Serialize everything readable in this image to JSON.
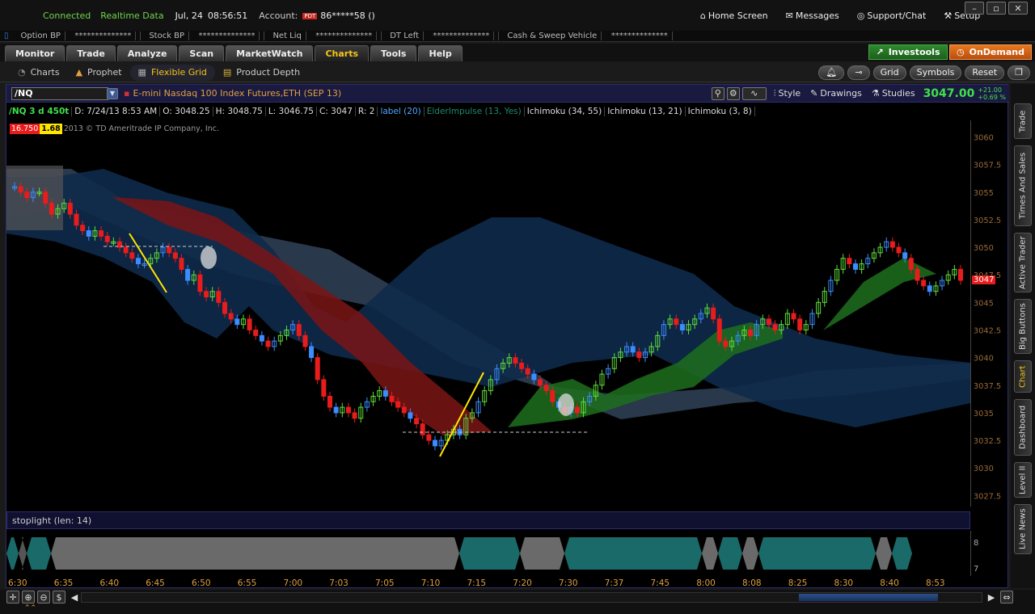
{
  "topbar": {
    "status": "Connected",
    "feed": "Realtime Data",
    "date": "Jul, 24",
    "time": "08:56:51",
    "account_label": "Account:",
    "pdt": "PDT",
    "account": "86*****58 ()",
    "home": "Home Screen",
    "messages": "Messages",
    "support": "Support/Chat",
    "setup": "Setup"
  },
  "acct": {
    "option_bp": "Option BP",
    "option_bp_val": "**************",
    "stock_bp": "Stock BP",
    "stock_bp_val": "**************",
    "net_liq": "Net Liq",
    "net_liq_val": "**************",
    "dt_left": "DT Left",
    "dt_left_val": "**************",
    "cash": "Cash & Sweep Vehicle",
    "cash_val": "**************"
  },
  "tabs": [
    "Monitor",
    "Trade",
    "Analyze",
    "Scan",
    "MarketWatch",
    "Charts",
    "Tools",
    "Help"
  ],
  "brand": {
    "investools": "Investools",
    "ondemand": "OnDemand"
  },
  "subtabs": [
    "Charts",
    "Prophet",
    "Flexible Grid",
    "Product Depth"
  ],
  "right_pills": {
    "grid": "Grid",
    "symbols": "Symbols",
    "reset": "Reset"
  },
  "chart": {
    "symbol": "/NQ",
    "description": "E-mini Nasdaq 100 Index Futures,ETH (SEP 13)",
    "style": "Style",
    "drawings": "Drawings",
    "studies": "Studies",
    "last": "3047.00",
    "change": "+21.00",
    "change_pct": "+0.69 %",
    "info": {
      "agg": "/NQ 3 d 450t",
      "d": "D: 7/24/13 8:53 AM",
      "o": "O: 3048.25",
      "h": "H: 3048.75",
      "l": "L: 3046.75",
      "c": "C: 3047",
      "r": "R: 2",
      "label": "label (20)",
      "elder": "ElderImpulse (13, Yes)",
      "ichi1": "Ichimoku (34, 55)",
      "ichi2": "Ichimoku (13, 21)",
      "ichi3": "Ichimoku (3, 8)"
    },
    "badge_red": "16.750",
    "badge_yellow": "1.68",
    "copyright": "2013 © TD Ameritrade IP Company, Inc.",
    "price_marker": "3047",
    "lower_title": "stoplight (len: 14)"
  },
  "rightside": [
    "Trade",
    "Times And Sales",
    "Active Trader",
    "Big Buttons",
    "Chart",
    "Dashboard",
    "Level II",
    "Live News"
  ],
  "chart_data": {
    "type": "candlestick",
    "title": "/NQ 3 d 450t",
    "y_ticks": [
      3060,
      3057.5,
      3055,
      3052.5,
      3050,
      3047.5,
      3045,
      3042.5,
      3040,
      3037.5,
      3035,
      3032.5,
      3030,
      3027.5
    ],
    "ylim": [
      3026.5,
      3061.5
    ],
    "x_ticks": [
      "6:30",
      "6:35",
      "6:40",
      "6:45",
      "6:50",
      "6:55",
      "7:00",
      "7:03",
      "7:05",
      "7:10",
      "7:15",
      "7:20",
      "7:30",
      "7:37",
      "7:45",
      "8:00",
      "8:08",
      "8:25",
      "8:30",
      "8:40",
      "8:53"
    ],
    "close": [
      3055.5,
      3055,
      3054.5,
      3055,
      3055,
      3054,
      3053,
      3053.5,
      3054,
      3053,
      3052,
      3051.5,
      3051,
      3051.5,
      3051,
      3050.5,
      3050.5,
      3050,
      3049.5,
      3049,
      3048.5,
      3048.5,
      3049,
      3049.5,
      3050,
      3049.5,
      3049,
      3048,
      3047,
      3047.5,
      3046,
      3045.5,
      3046,
      3045,
      3044,
      3043.5,
      3043,
      3043.5,
      3042.5,
      3042,
      3041.5,
      3041,
      3041.5,
      3042,
      3042.5,
      3043,
      3042,
      3041,
      3040,
      3038,
      3036.5,
      3035.5,
      3035,
      3035.5,
      3035,
      3034.5,
      3035.5,
      3036,
      3036.5,
      3037,
      3036.5,
      3036,
      3035.5,
      3035,
      3034.5,
      3034,
      3033,
      3032.5,
      3032,
      3032.5,
      3033,
      3033.5,
      3033,
      3034.5,
      3035,
      3036,
      3037,
      3038,
      3039,
      3039.5,
      3040,
      3039.5,
      3039,
      3038.5,
      3038,
      3037.5,
      3037,
      3036,
      3035.5,
      3035,
      3035.5,
      3035,
      3036,
      3036.5,
      3037.5,
      3038.5,
      3039,
      3040,
      3040.5,
      3041,
      3040.5,
      3040,
      3040.5,
      3041,
      3042,
      3043,
      3043.5,
      3043,
      3042.5,
      3043,
      3043.5,
      3044,
      3044.5,
      3043.5,
      3041.5,
      3041,
      3041.5,
      3042,
      3042.5,
      3042,
      3043,
      3043.5,
      3043,
      3042.5,
      3043,
      3044,
      3043.5,
      3042.5,
      3043,
      3044,
      3045,
      3046,
      3047,
      3048,
      3049,
      3048.5,
      3048,
      3048.5,
      3049,
      3049.5,
      3050,
      3050.5,
      3050,
      3049.5,
      3049,
      3048,
      3047,
      3046.5,
      3046,
      3046.5,
      3047,
      3047.5,
      3048,
      3047
    ]
  },
  "stoplight": {
    "y_ticks": [
      "8",
      "7"
    ]
  }
}
